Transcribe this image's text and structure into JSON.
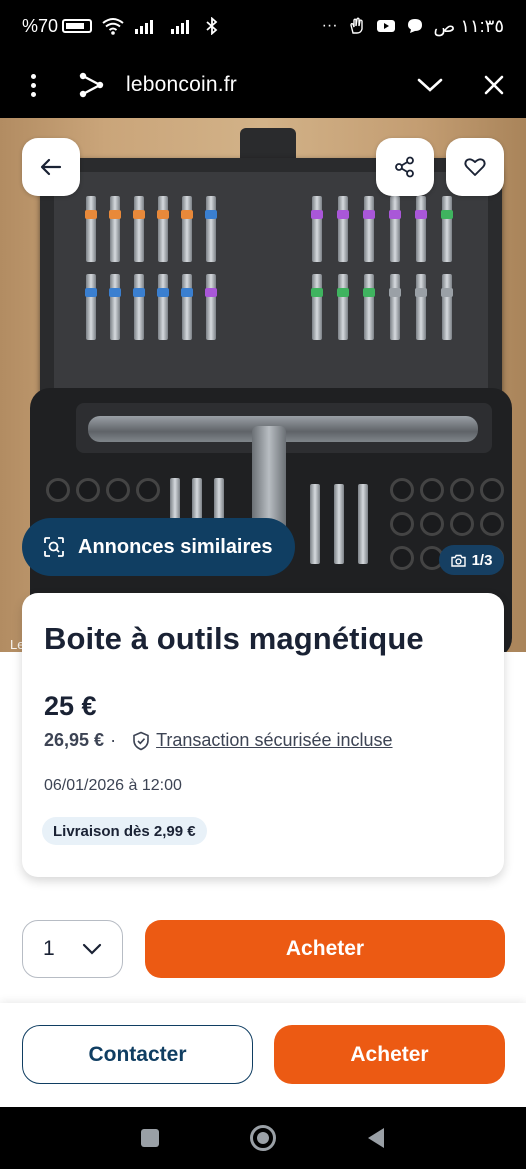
{
  "status_bar": {
    "battery": "%70",
    "time": "١١:٣٥ ص",
    "more": "···"
  },
  "browser": {
    "url": "leboncoin.fr"
  },
  "photo": {
    "similar_label": "Annonces similaires",
    "counter": "1/3",
    "credit": "Le"
  },
  "listing": {
    "title": "Boite à outils magnétique",
    "price": "25 €",
    "total_price": "26,95 €",
    "separator": "·",
    "secure_label": "Transaction sécurisée incluse",
    "date": "06/01/2026 à 12:00",
    "delivery": "Livraison dès 2,99 €"
  },
  "purchase": {
    "quantity": "1",
    "buy_label": "Acheter"
  },
  "bottom_bar": {
    "contact_label": "Contacter",
    "buy_label": "Acheter"
  },
  "colors": {
    "brand_orange": "#ec5a13",
    "brand_navy": "#103e62",
    "text_dark": "#1a2234"
  }
}
